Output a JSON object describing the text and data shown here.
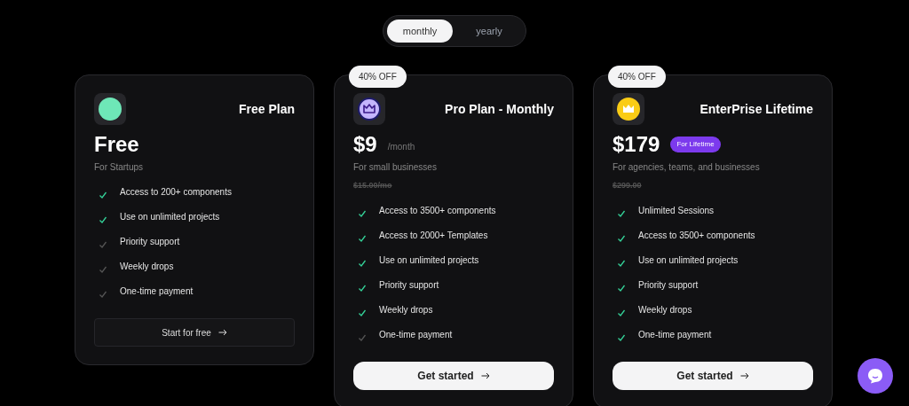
{
  "billing_toggle": [
    {
      "label": "monthly",
      "selected": true
    },
    {
      "label": "yearly",
      "selected": false
    }
  ],
  "plans": [
    {
      "kind": "free",
      "name": "Free Plan",
      "price": "Free",
      "audience": "For Startups",
      "button": {
        "label": "Start for free",
        "primary": false
      },
      "features": [
        {
          "text": "Access to 200+ components",
          "included": true
        },
        {
          "text": "Use on unlimited projects",
          "included": true
        },
        {
          "text": "Priority support",
          "included": false
        },
        {
          "text": "Weekly drops",
          "included": false
        },
        {
          "text": "One-time payment",
          "included": false
        }
      ]
    },
    {
      "kind": "pro",
      "badge": "40% OFF",
      "name": "Pro Plan - Monthly",
      "price": "$9",
      "period": "/month",
      "audience": "For small businesses",
      "old_price": "$15.00/mo",
      "button": {
        "label": "Get started",
        "primary": true
      },
      "features": [
        {
          "text": "Access to 3500+ components",
          "included": true
        },
        {
          "text": "Access to 2000+ Templates",
          "included": true
        },
        {
          "text": "Use on unlimited projects",
          "included": true
        },
        {
          "text": "Priority support",
          "included": true
        },
        {
          "text": "Weekly drops",
          "included": true
        },
        {
          "text": "One-time payment",
          "included": false
        }
      ]
    },
    {
      "kind": "enterprise",
      "badge": "40% OFF",
      "name": "EnterPrise Lifetime",
      "price": "$179",
      "tag": "For Lifetime",
      "audience": "For agencies, teams, and businesses",
      "old_price": "$299.00",
      "button": {
        "label": "Get started",
        "primary": true
      },
      "features": [
        {
          "text": "Unlimited Sessions",
          "included": true
        },
        {
          "text": "Access to 3500+ components",
          "included": true
        },
        {
          "text": "Use on unlimited projects",
          "included": true
        },
        {
          "text": "Priority support",
          "included": true
        },
        {
          "text": "Weekly drops",
          "included": true
        },
        {
          "text": "One-time payment",
          "included": true
        }
      ]
    }
  ]
}
